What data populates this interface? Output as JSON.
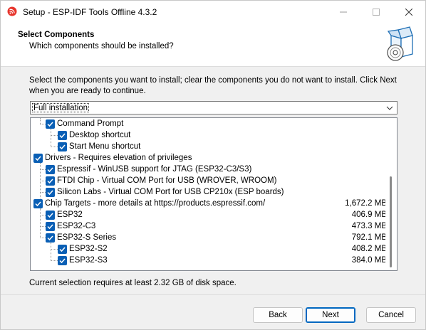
{
  "window": {
    "title": "Setup - ESP-IDF Tools Offline 4.3.2",
    "icon": "espressif-logo-icon",
    "controls": [
      "minimize-icon",
      "maximize-icon",
      "close-icon"
    ]
  },
  "header": {
    "title": "Select Components",
    "subtitle": "Which components should be installed?",
    "icon": "install-box-disc-icon"
  },
  "instructions": "Select the components you want to install; clear the components you do not want to install. Click Next when you are ready to continue.",
  "preset": {
    "selected": "Full installation"
  },
  "components": [
    {
      "label": "Command Prompt",
      "checked": true,
      "level": 1,
      "size": ""
    },
    {
      "label": "Desktop shortcut",
      "checked": true,
      "level": 2,
      "size": ""
    },
    {
      "label": "Start Menu shortcut",
      "checked": true,
      "level": 2,
      "size": ""
    },
    {
      "label": "Drivers - Requires elevation of privileges",
      "checked": true,
      "level": 0,
      "size": ""
    },
    {
      "label": "Espressif - WinUSB support for JTAG (ESP32-C3/S3)",
      "checked": true,
      "level": 1,
      "size": ""
    },
    {
      "label": "FTDI Chip - Virtual COM Port for USB (WROVER, WROOM)",
      "checked": true,
      "level": 1,
      "size": ""
    },
    {
      "label": "Silicon Labs - Virtual COM Port for USB CP210x (ESP boards)",
      "checked": true,
      "level": 1,
      "size": ""
    },
    {
      "label": "Chip Targets - more details at https://products.espressif.com/",
      "checked": true,
      "level": 0,
      "size": "1,672.2 MB"
    },
    {
      "label": "ESP32",
      "checked": true,
      "level": 1,
      "size": "406.9 MB"
    },
    {
      "label": "ESP32-C3",
      "checked": true,
      "level": 1,
      "size": "473.3 MB"
    },
    {
      "label": "ESP32-S Series",
      "checked": true,
      "level": 1,
      "size": "792.1 MB"
    },
    {
      "label": "ESP32-S2",
      "checked": true,
      "level": 2,
      "size": "408.2 MB"
    },
    {
      "label": "ESP32-S3",
      "checked": true,
      "level": 2,
      "size": "384.0 MB"
    }
  ],
  "disk_space": "Current selection requires at least 2.32 GB of disk space.",
  "buttons": {
    "back": "Back",
    "next": "Next",
    "cancel": "Cancel"
  },
  "colors": {
    "checkbox": "#0a5fb5",
    "accent": "#0067c0",
    "logo": "#e7352c"
  }
}
